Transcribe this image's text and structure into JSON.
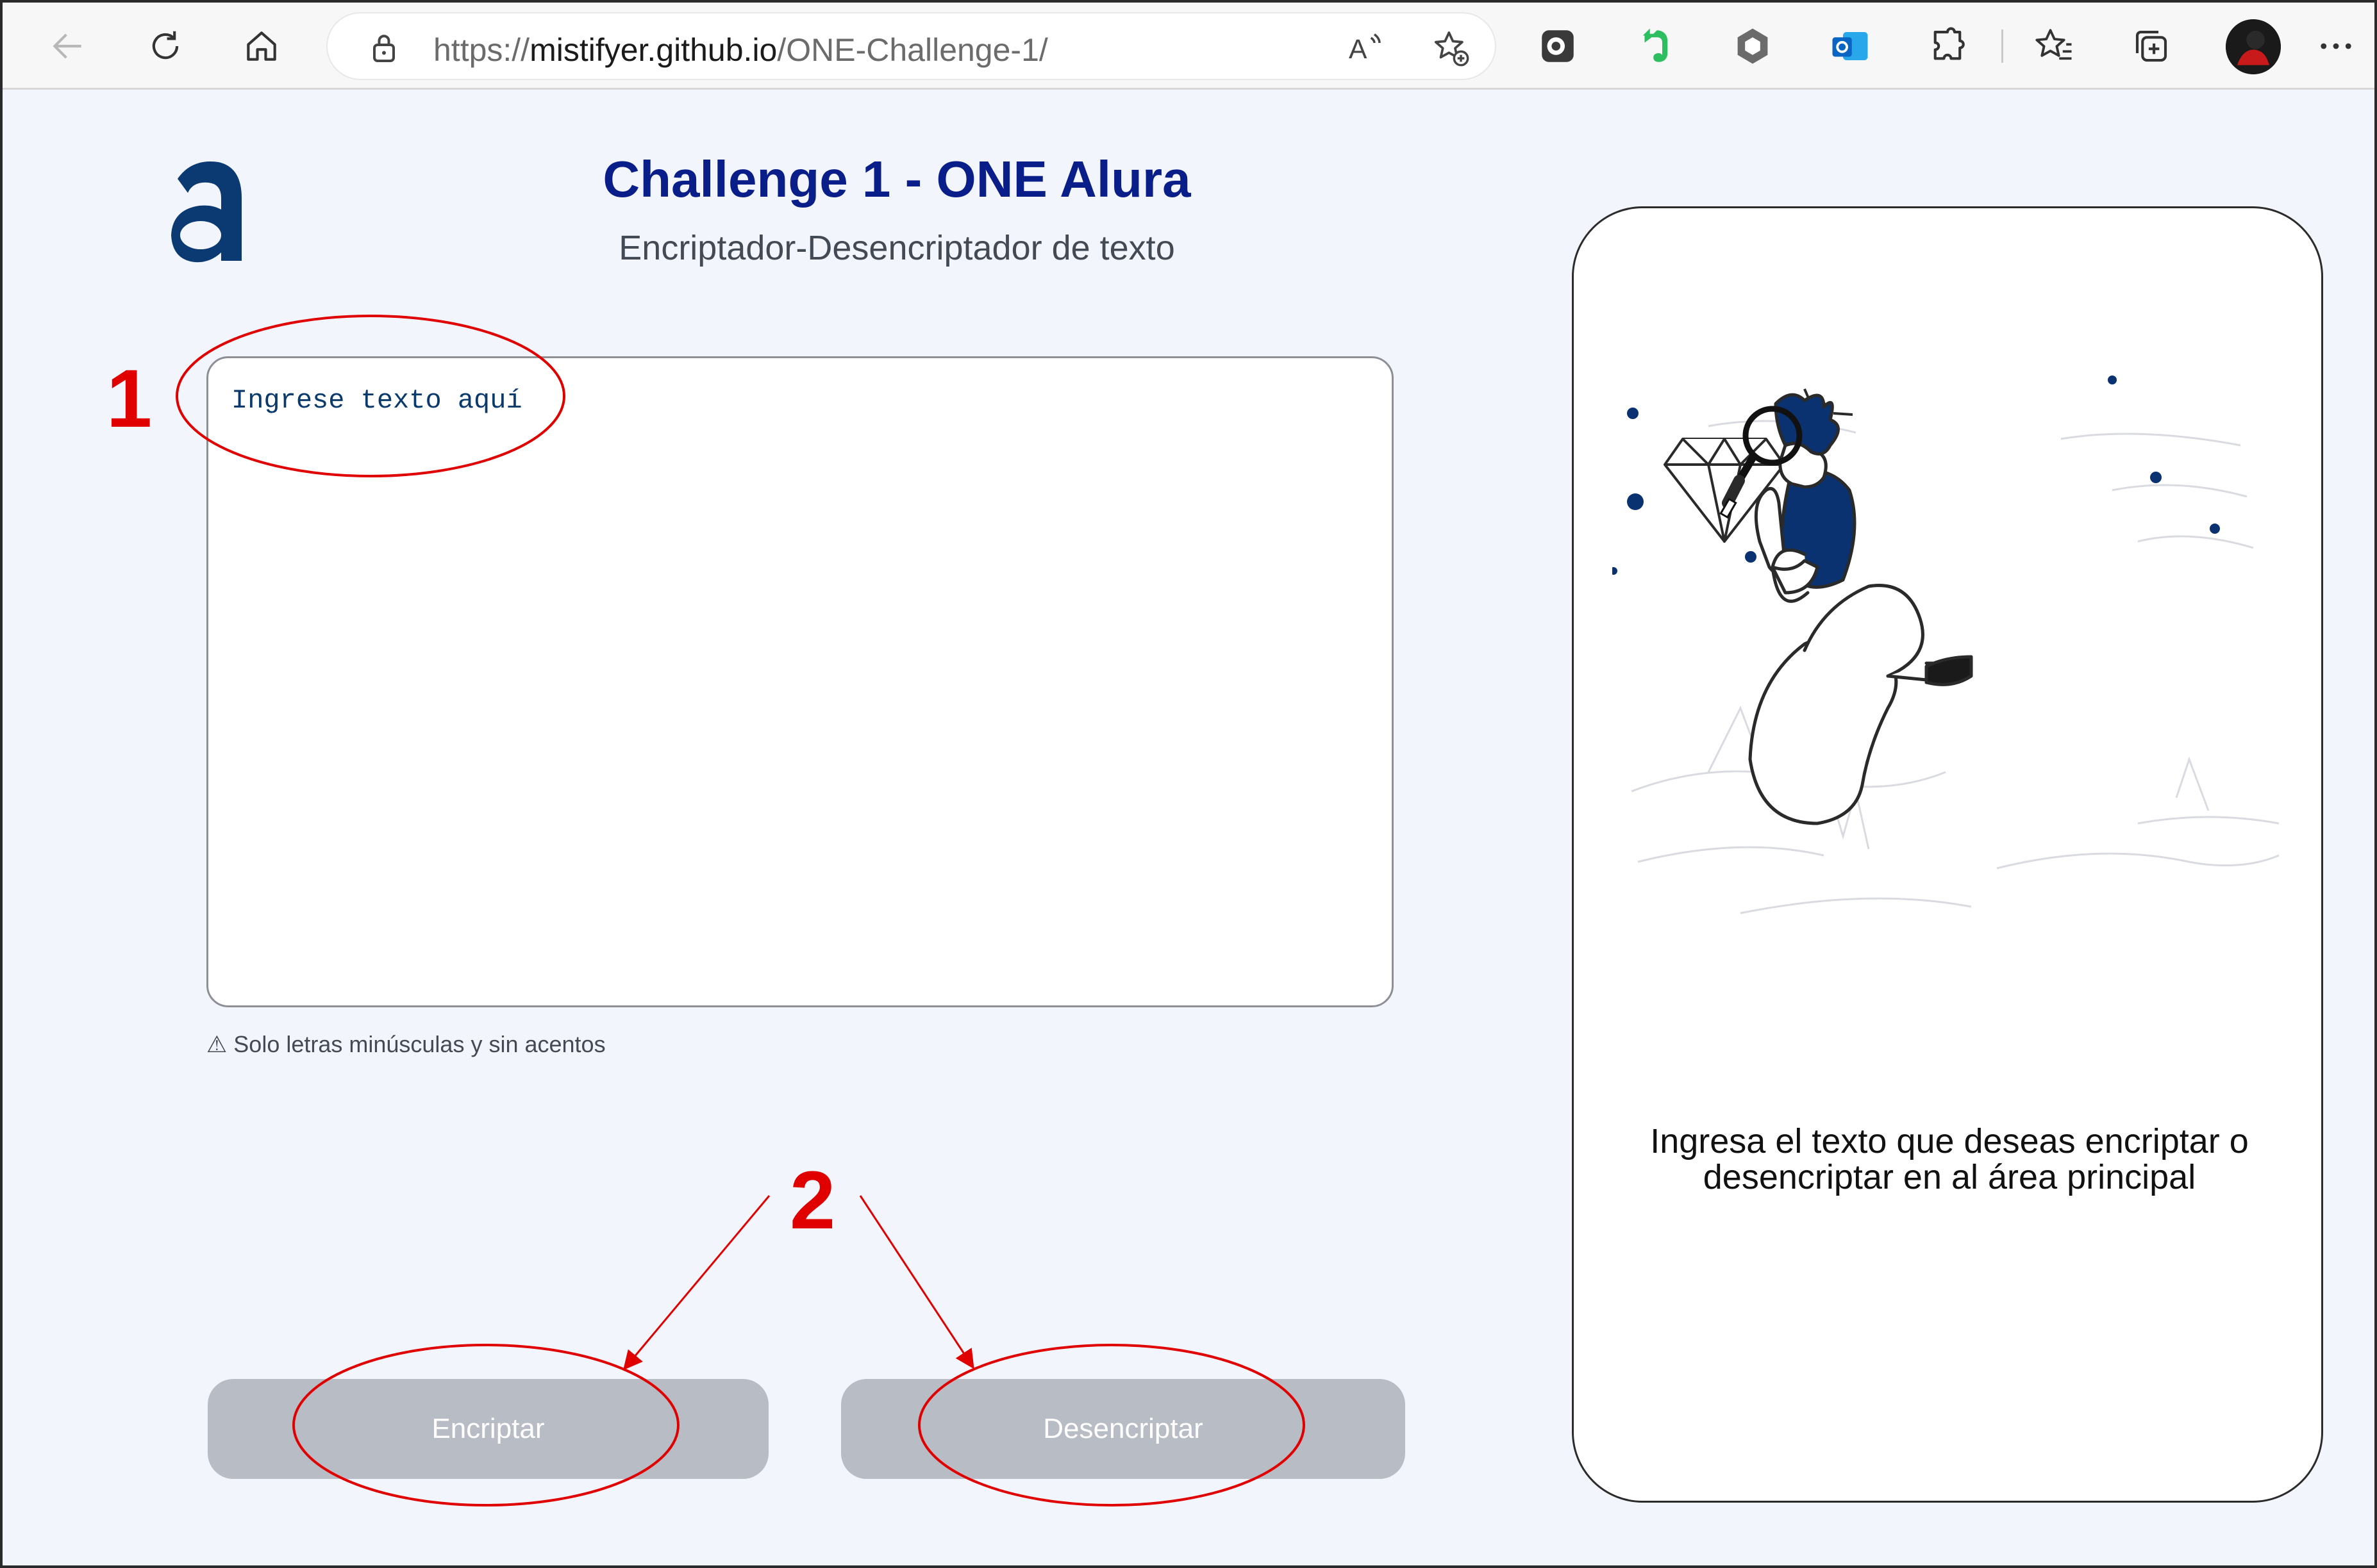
{
  "browser": {
    "url_prefix": "https://",
    "url_host": "mistifyer.github.io",
    "url_path": "/ONE-Challenge-1/",
    "icons": [
      "back-arrow-icon",
      "refresh-icon",
      "home-icon",
      "lock-icon",
      "read-aloud-icon",
      "add-favorite-icon",
      "extension-1-icon",
      "evernote-icon",
      "extension-3-icon",
      "outlook-icon",
      "extensions-puzzle-icon",
      "favorites-icon",
      "collections-icon",
      "profile-avatar",
      "more-options-icon"
    ]
  },
  "page": {
    "title": "Challenge 1 - ONE Alura",
    "subtitle": "Encriptador-Desencriptador de texto",
    "input_placeholder": "Ingrese texto aquí",
    "hint_icon": "⚠",
    "hint_text": "Solo letras minúsculas y sin acentos",
    "encrypt_button": "Encriptar",
    "decrypt_button": "Desencriptar",
    "output_message": "Ingresa el texto que deseas encriptar o desencriptar en al área principal"
  },
  "annotations": {
    "marker_1": "1",
    "marker_2": "2",
    "color": "#e10000"
  },
  "colors": {
    "title": "#0a1e8a",
    "button_bg": "#b8bcc4",
    "page_bg": "#f3f5fc",
    "illustration_blue": "#0b3270"
  }
}
